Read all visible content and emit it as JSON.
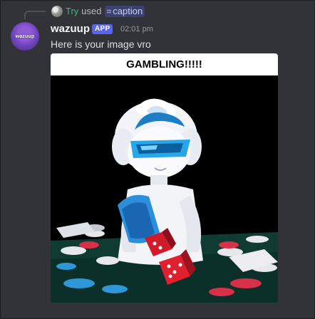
{
  "interaction": {
    "user_name": "Try",
    "verb": "used",
    "command_glyph": "⌗",
    "command": "caption"
  },
  "message": {
    "author": "wazuup",
    "badge": "APP",
    "timestamp": "02:01 pm",
    "text": "Here is your image vro",
    "avatar_logo": "wazuup"
  },
  "attachment": {
    "caption": "GAMBLING!!!!!",
    "icon": "gambling-character-image"
  },
  "colors": {
    "background": "#313338",
    "username": "#f2f3f5",
    "try_name": "#43b581",
    "app_badge": "#5865f2",
    "command_pill": "#3c4270"
  }
}
